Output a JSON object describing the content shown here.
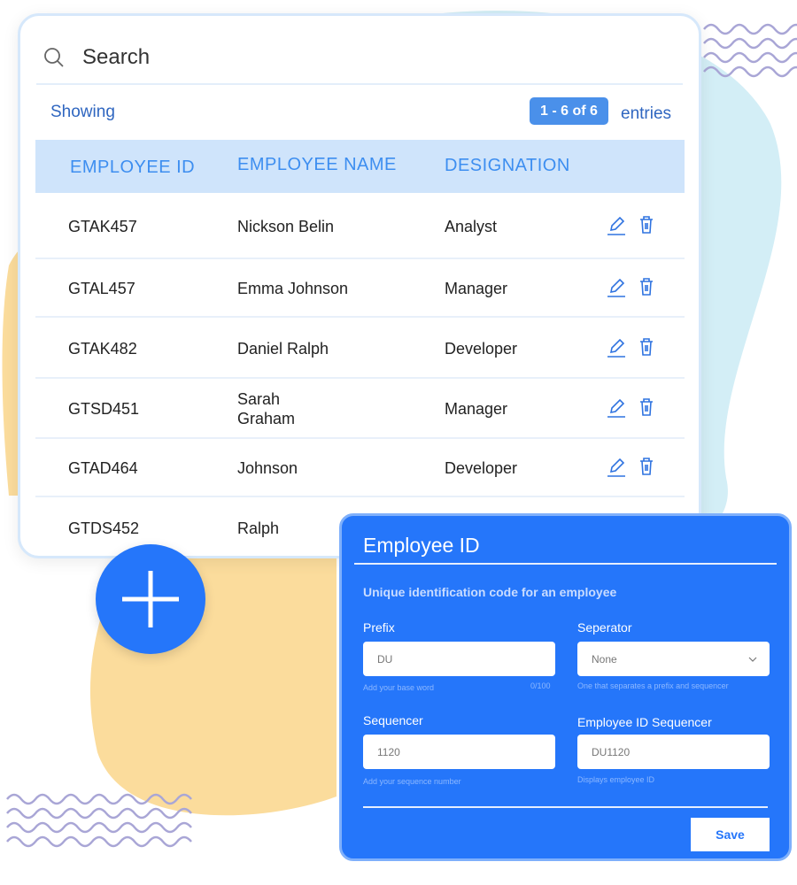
{
  "search": {
    "placeholder": "Search"
  },
  "pagination": {
    "showing": "Showing",
    "range": "1 - 6 of 6",
    "entries": "entries"
  },
  "table": {
    "columns": [
      "EMPLOYEE ID",
      "EMPLOYEE NAME",
      "DESIGNATION"
    ],
    "rows": [
      {
        "id": "GTAK457",
        "name": "Nickson Belin",
        "designation": "Analyst"
      },
      {
        "id": "GTAL457",
        "name": "Emma Johnson",
        "designation": "Manager"
      },
      {
        "id": "GTAK482",
        "name": "Daniel Ralph",
        "designation": "Developer"
      },
      {
        "id": "GTSD451",
        "name": "Sarah\nGraham",
        "designation": "Manager"
      },
      {
        "id": "GTAD464",
        "name": "Johnson",
        "designation": "Developer"
      },
      {
        "id": "GTDS452",
        "name": "Ralph",
        "designation": ""
      }
    ]
  },
  "modal": {
    "title": "Employee ID",
    "subtitle": "Unique identification code for an employee",
    "prefix": {
      "label": "Prefix",
      "value": "DU",
      "hint": "Add your base word",
      "counter": "0/100"
    },
    "separator": {
      "label": "Seperator",
      "value": "None",
      "hint": "One that separates a prefix and sequencer"
    },
    "sequencer": {
      "label": "Sequencer",
      "value": "1120",
      "hint": "Add your sequence number"
    },
    "id_sequencer": {
      "label": "Employee ID Sequencer",
      "value": "DU1120",
      "hint": "Displays employee ID"
    },
    "save": "Save"
  },
  "colors": {
    "accent": "#2576fa",
    "header_bg": "#cfe4fb",
    "yellow_blob": "#fbdc9c",
    "blue_blob": "#d3eef6",
    "wave": "#a9a6d6"
  }
}
